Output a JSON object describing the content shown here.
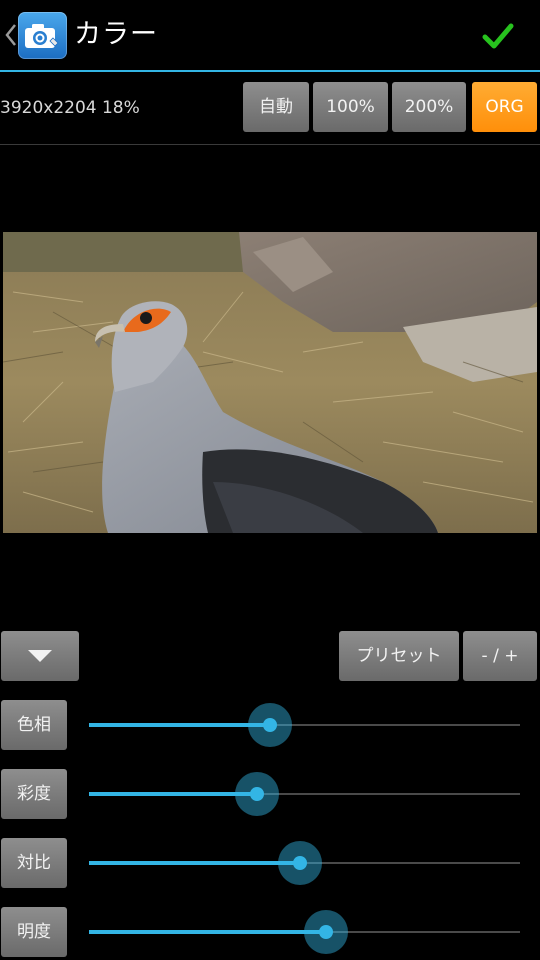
{
  "actionbar": {
    "title": "カラー",
    "accent_color": "#33b5e5",
    "up_icon": "chevron-left-icon",
    "app_icon": "camera-app-icon",
    "done_icon": "checkmark-icon"
  },
  "info": {
    "image_info": "3920x2204 18%"
  },
  "zoom_buttons": {
    "auto": "自動",
    "p100": "100%",
    "p200": "200%",
    "org": "ORG",
    "org_color": "#ff9a1f"
  },
  "controls": {
    "collapse_icon": "triangle-down-icon",
    "preset_label": "プリセット",
    "plusminus_label": "- / +"
  },
  "sliders": [
    {
      "label": "色相",
      "value": 0.42
    },
    {
      "label": "彩度",
      "value": 0.39
    },
    {
      "label": "対比",
      "value": 0.49
    },
    {
      "label": "明度",
      "value": 0.55
    }
  ]
}
